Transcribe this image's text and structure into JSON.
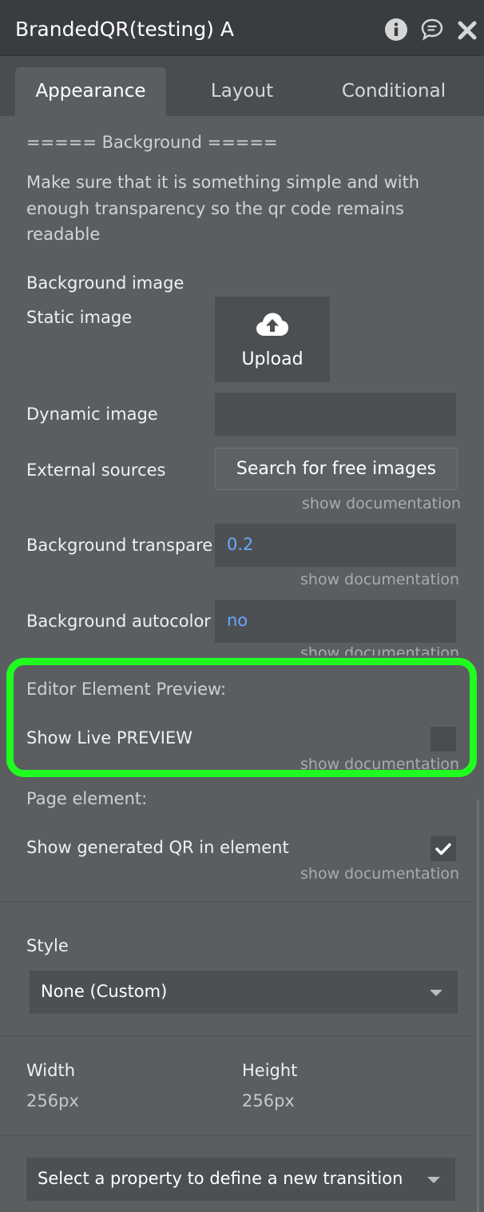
{
  "window": {
    "title": "BrandedQR(testing) A"
  },
  "tabs": [
    {
      "label": "Appearance",
      "active": true
    },
    {
      "label": "Layout",
      "active": false
    },
    {
      "label": "Conditional",
      "active": false
    }
  ],
  "background": {
    "section_header": "===== Background =====",
    "description": "Make sure that it is something simple and with enough transparency so the qr code remains readable",
    "background_image_label": "Background image",
    "static_image_label": "Static image",
    "upload_label": "Upload",
    "dynamic_image_label": "Dynamic image",
    "dynamic_image_value": "",
    "external_sources_label": "External sources",
    "search_images_label": "Search for free images",
    "transparency_label": "Background transpare",
    "transparency_value": "0.2",
    "autocolor_label": "Background autocolor",
    "autocolor_value": "no",
    "show_documentation": "show documentation"
  },
  "editor_preview": {
    "header": "Editor Element Preview:",
    "live_preview_label": "Show Live PREVIEW",
    "live_preview_checked": false
  },
  "page_element": {
    "header": "Page element:",
    "show_qr_label": "Show generated QR in element",
    "show_qr_checked": true
  },
  "style": {
    "label": "Style",
    "selected": "None (Custom)"
  },
  "dimensions": {
    "width_label": "Width",
    "width_value": "256px",
    "height_label": "Height",
    "height_value": "256px"
  },
  "transition": {
    "placeholder": "Select a property to define a new transition"
  },
  "colors": {
    "panel_bg": "#5b5e61",
    "header_bg": "#3a3d40",
    "value_text": "#68a8ff",
    "highlight": "#1fff1f"
  }
}
